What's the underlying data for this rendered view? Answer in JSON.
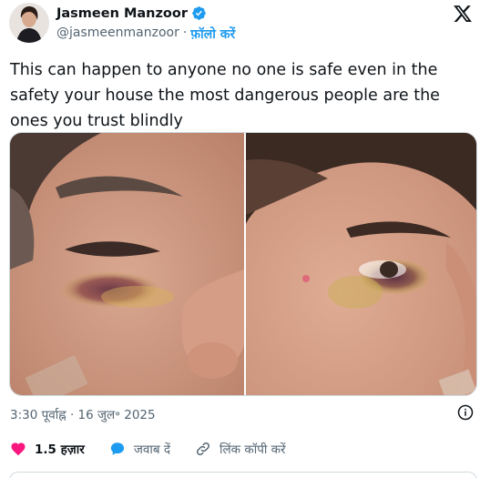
{
  "author": {
    "name": "Jasmeen Manzoor",
    "handle": "@jasmeenmanzoor",
    "separator": "·",
    "follow_label": "फ़ॉलो करें",
    "verified": true
  },
  "tweet": {
    "text": "This can happen to anyone no one is safe even in the safety your house the most dangerous people are the ones you trust blindly",
    "media_count": 2,
    "timestamp": "3:30 पूर्वाह्न · 16 जुल॰ 2025"
  },
  "actions": {
    "likes_count": "1.5 हज़ार",
    "reply_label": "जवाब दें",
    "copy_link_label": "लिंक कॉपी करें"
  },
  "colors": {
    "accent": "#1d9bf0",
    "like": "#f91880",
    "text_secondary": "#536471"
  },
  "icons": [
    "verified-badge-icon",
    "x-logo-icon",
    "info-icon",
    "heart-icon",
    "reply-bubble-icon",
    "link-icon"
  ]
}
